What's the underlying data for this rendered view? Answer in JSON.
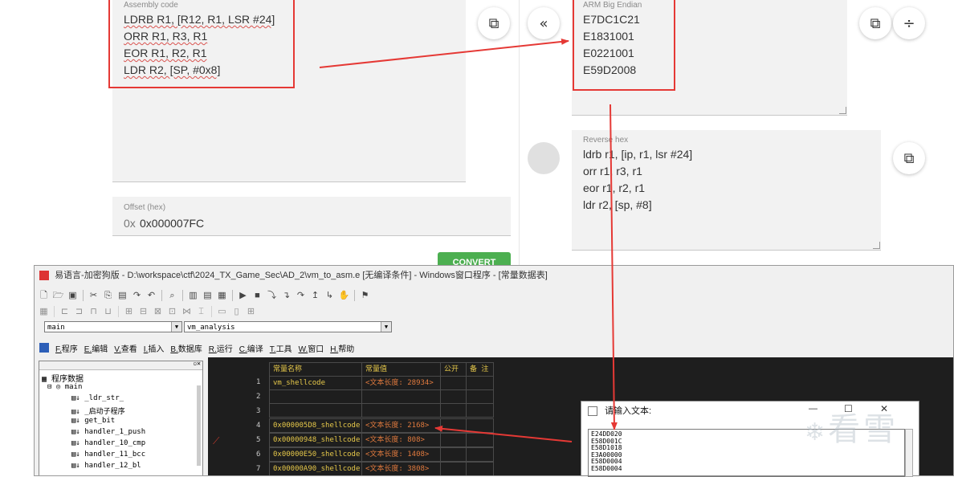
{
  "converter": {
    "assembly": {
      "label": "Assembly code",
      "lines": [
        "LDRB R1, [R12, R1, LSR #24]",
        "ORR R1, R3, R1",
        "EOR R1, R2, R1",
        "LDR R2, [SP, #0x8]"
      ]
    },
    "offset": {
      "label": "Offset (hex)",
      "prefix": "0x",
      "value": "0x000007FC"
    },
    "convert_button": "CONVERT",
    "swap_icon": "«",
    "big_endian": {
      "label": "ARM Big Endian",
      "lines": [
        "E7DC1C21",
        "E1831001",
        "E0221001",
        "E59D2008"
      ]
    },
    "reverse_hex": {
      "label": "Reverse hex",
      "lines": [
        "ldrb r1, [ip, r1, lsr #24]",
        "orr r1, r3, r1",
        "eor r1, r2, r1",
        "ldr r2, [sp, #8]"
      ]
    },
    "icons": {
      "copy": "copy-icon",
      "split": "divide-icon",
      "swap": "chevron-left-double-icon"
    },
    "accent_color": "#4caf50",
    "highlight_color": "#e53935"
  },
  "ide": {
    "title": "易语言-加密狗版 - D:\\workspace\\ctf\\2024_TX_Game_Sec\\AD_2\\vm_to_asm.e [无编译条件] - Windows窗口程序 - [常量数据表]",
    "combo_left": "main",
    "combo_right": "vm_analysis",
    "menu": [
      {
        "key": "F.",
        "label": "程序"
      },
      {
        "key": "E.",
        "label": "编辑"
      },
      {
        "key": "V.",
        "label": "查看"
      },
      {
        "key": "I.",
        "label": "插入"
      },
      {
        "key": "B.",
        "label": "数据库"
      },
      {
        "key": "R.",
        "label": "运行"
      },
      {
        "key": "C.",
        "label": "编译"
      },
      {
        "key": "T.",
        "label": "工具"
      },
      {
        "key": "W.",
        "label": "窗口"
      },
      {
        "key": "H.",
        "label": "帮助"
      }
    ],
    "tree": {
      "root": "程序数据",
      "main": "main",
      "items": [
        "_ldr_str_",
        "_启动子程序",
        "get_bit",
        "handler_1_push",
        "handler_10_cmp",
        "handler_11_bcc",
        "handler_12_bl"
      ]
    },
    "table": {
      "headers": [
        "常量名称",
        "常量值",
        "公开",
        "备 注"
      ],
      "rows": [
        {
          "n": "1",
          "name": "vm_shellcode",
          "value": "<文本长度: 28934>"
        },
        {
          "n": "2",
          "name": "",
          "value": ""
        },
        {
          "n": "3",
          "name": "",
          "value": ""
        },
        {
          "n": "4",
          "name": "0x000005D8_shellcode",
          "value": "<文本长度: 2168>"
        },
        {
          "n": "5",
          "name": "0x00000948_shellcode",
          "value": "<文本长度: 808>"
        },
        {
          "n": "6",
          "name": "0x00000E50_shellcode",
          "value": "<文本长度: 1408>"
        },
        {
          "n": "7",
          "name": "0x00000A90_shellcode",
          "value": "<文本长度: 3808>"
        }
      ]
    }
  },
  "dialog": {
    "title": "请输入文本:",
    "lines": [
      "E24DD020",
      "E58D001C",
      "E58D1018",
      "E3A00000",
      "E58D0004",
      "E58D0004"
    ],
    "min": "—",
    "max": "☐",
    "close": "✕"
  },
  "watermark": "看雪"
}
